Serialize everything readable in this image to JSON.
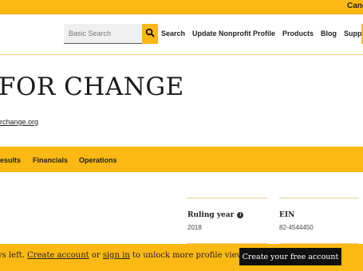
{
  "top_bar": {
    "link_label": "Cand"
  },
  "search": {
    "placeholder": "Basic Search"
  },
  "nav": {
    "items": [
      {
        "label": "Search"
      },
      {
        "label": "Update Nonprofit Profile"
      },
      {
        "label": "Products"
      },
      {
        "label": "Blog"
      },
      {
        "label": "Support"
      }
    ]
  },
  "org": {
    "title": "FOR CHANGE",
    "url": "rchange.org"
  },
  "tabs": [
    {
      "label": "esults"
    },
    {
      "label": "Financials"
    },
    {
      "label": "Operations"
    }
  ],
  "info": {
    "ruling_year_label": "Ruling year",
    "ruling_year_value": "2018",
    "ein_label": "EIN",
    "ein_value": "82-4544450"
  },
  "banner": {
    "prefix": "vs left. ",
    "create_link": "Create account",
    "or_text": " or ",
    "signin_link": "sign in",
    "suffix": " to unlock more profile views.",
    "button_label": "Create your free account"
  },
  "colors": {
    "accent": "#fdb913",
    "button_dark": "#111111"
  }
}
